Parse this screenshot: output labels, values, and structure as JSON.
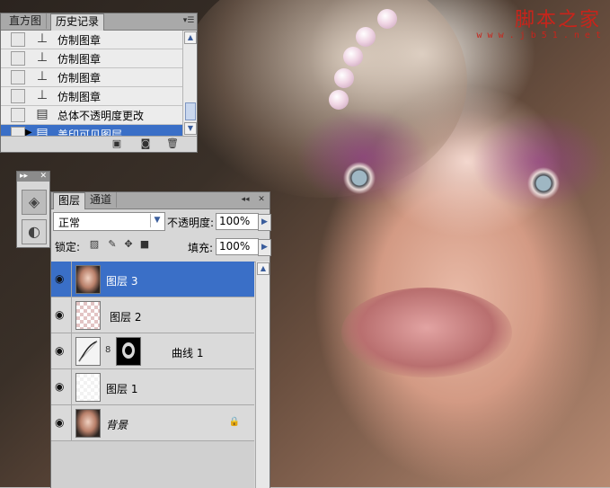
{
  "watermark": {
    "title": "脚本之家",
    "url": "w w w . j b 5 1 . n e t"
  },
  "history_panel": {
    "tabs": [
      "直方图",
      "历史记录"
    ],
    "active_tab_index": 1,
    "items": [
      {
        "label": "仿制图章",
        "icon": "clone-stamp-icon"
      },
      {
        "label": "仿制图章",
        "icon": "clone-stamp-icon"
      },
      {
        "label": "仿制图章",
        "icon": "clone-stamp-icon"
      },
      {
        "label": "仿制图章",
        "icon": "clone-stamp-icon"
      },
      {
        "label": "总体不透明度更改",
        "icon": "document-icon"
      },
      {
        "label": "盖印可见图层",
        "icon": "document-icon"
      }
    ],
    "selected_index": 5,
    "footer_icons": [
      "new-document-from-state-icon",
      "new-snapshot-icon",
      "delete-icon"
    ]
  },
  "mini_tools": {
    "buttons": [
      "layers-panel-icon",
      "channels-panel-icon"
    ]
  },
  "layers_panel": {
    "tabs": [
      "图层",
      "通道"
    ],
    "active_tab_index": 0,
    "blend_mode": "正常",
    "opacity_label": "不透明度:",
    "opacity_value": "100%",
    "lock_label": "锁定:",
    "fill_label": "填充:",
    "fill_value": "100%",
    "layers": [
      {
        "name": "图层 3",
        "thumb": "face",
        "selected": true
      },
      {
        "name": "图层 2",
        "thumb": "trans",
        "selected": false
      },
      {
        "name": "曲线 1",
        "thumb": "curve",
        "selected": false,
        "has_mask": true
      },
      {
        "name": "图层 1",
        "thumb": "trans",
        "selected": false
      },
      {
        "name": "背景",
        "thumb": "face",
        "selected": false,
        "locked": true
      }
    ]
  },
  "colors": {
    "selection": "#3a6fc7",
    "panel_bg": "#d7d7d7",
    "watermark": "#c8241b"
  }
}
